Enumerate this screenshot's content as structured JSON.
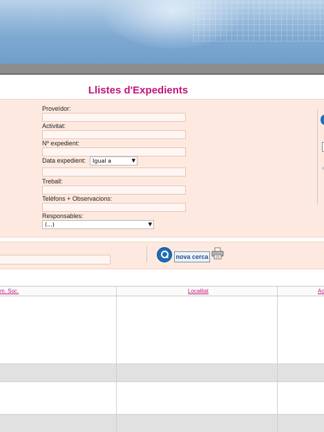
{
  "page": {
    "title": "Llistes d'Expedients"
  },
  "form": {
    "proveidor_label": "Proveïdor:",
    "activitat_label": "Activitat:",
    "num_expedient_label": "Nº expedient:",
    "data_expedient_label": "Data expedient:",
    "data_operator_value": "Igual a",
    "treball_label": "Treball:",
    "telefons_label": "Telèfons + Observacions:",
    "responsables_label": "Responsables:",
    "responsables_value": "(...)"
  },
  "search": {
    "nova_cerca_label": "nova cerca"
  },
  "table": {
    "headers": [
      "m. Soc.",
      "Localitat",
      "Ac"
    ]
  },
  "colors": {
    "title": "#c0147a",
    "panel_bg": "#fde9df",
    "header_link": "#c0147a",
    "button_blue": "#1d6cb5"
  }
}
